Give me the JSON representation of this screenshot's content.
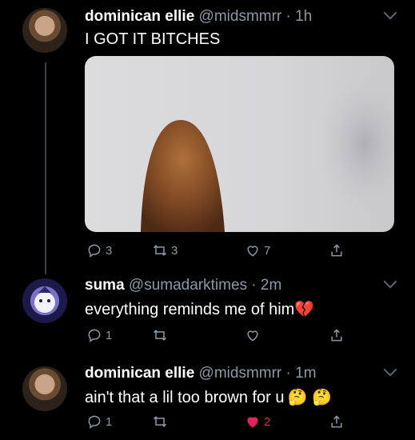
{
  "tweets": [
    {
      "display_name": "dominican ellie",
      "handle": "@midsmmrr",
      "time": "1h",
      "text": "I GOT IT BITCHES",
      "has_media": true,
      "replies": "3",
      "retweets": "3",
      "likes": "7"
    },
    {
      "display_name": "suma",
      "handle": "@sumadarktimes",
      "time": "2m",
      "text": "everything reminds me of him",
      "text_emoji": "💔",
      "replies": "1",
      "retweets": "",
      "likes": ""
    },
    {
      "display_name": "dominican ellie",
      "handle": "@midsmmrr",
      "time": "1m",
      "text": "ain't that a lil too brown for u",
      "text_emoji": "🤔 🤔",
      "replies": "1",
      "retweets": "",
      "likes": "2",
      "liked": true
    }
  ],
  "icons": {
    "reply": "reply-icon",
    "retweet": "retweet-icon",
    "like": "heart-icon",
    "share": "share-icon",
    "more": "chevron-down-icon"
  },
  "colors": {
    "background": "#000000",
    "muted": "#8b98a5",
    "like_active": "#e0245e"
  }
}
